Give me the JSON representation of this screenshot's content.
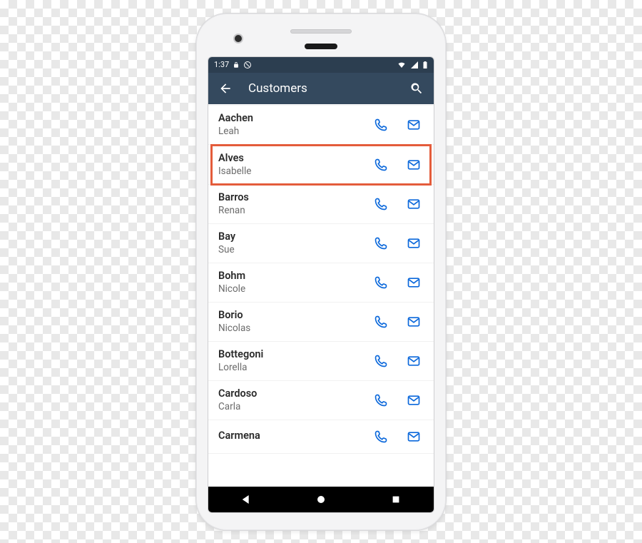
{
  "statusbar": {
    "time": "1:37",
    "icons_left": [
      "lock",
      "nosync"
    ],
    "icons_right": [
      "wifi",
      "signal",
      "battery"
    ]
  },
  "appbar": {
    "back_label": "back",
    "title": "Customers",
    "search_label": "search"
  },
  "highlight_index": 1,
  "colors": {
    "appbar": "#34495e",
    "statusbar": "#2c3e50",
    "accent_icon": "#0b68db",
    "highlight": "#e45c3b"
  },
  "customers": [
    {
      "lastname": "Aachen",
      "firstname": "Leah"
    },
    {
      "lastname": "Alves",
      "firstname": "Isabelle"
    },
    {
      "lastname": "Barros",
      "firstname": "Renan"
    },
    {
      "lastname": "Bay",
      "firstname": "Sue"
    },
    {
      "lastname": "Bohm",
      "firstname": "Nicole"
    },
    {
      "lastname": "Borio",
      "firstname": "Nicolas"
    },
    {
      "lastname": "Bottegoni",
      "firstname": "Lorella"
    },
    {
      "lastname": "Cardoso",
      "firstname": "Carla"
    },
    {
      "lastname": "Carmena",
      "firstname": ""
    }
  ],
  "actions": {
    "call_label": "call",
    "email_label": "email"
  }
}
